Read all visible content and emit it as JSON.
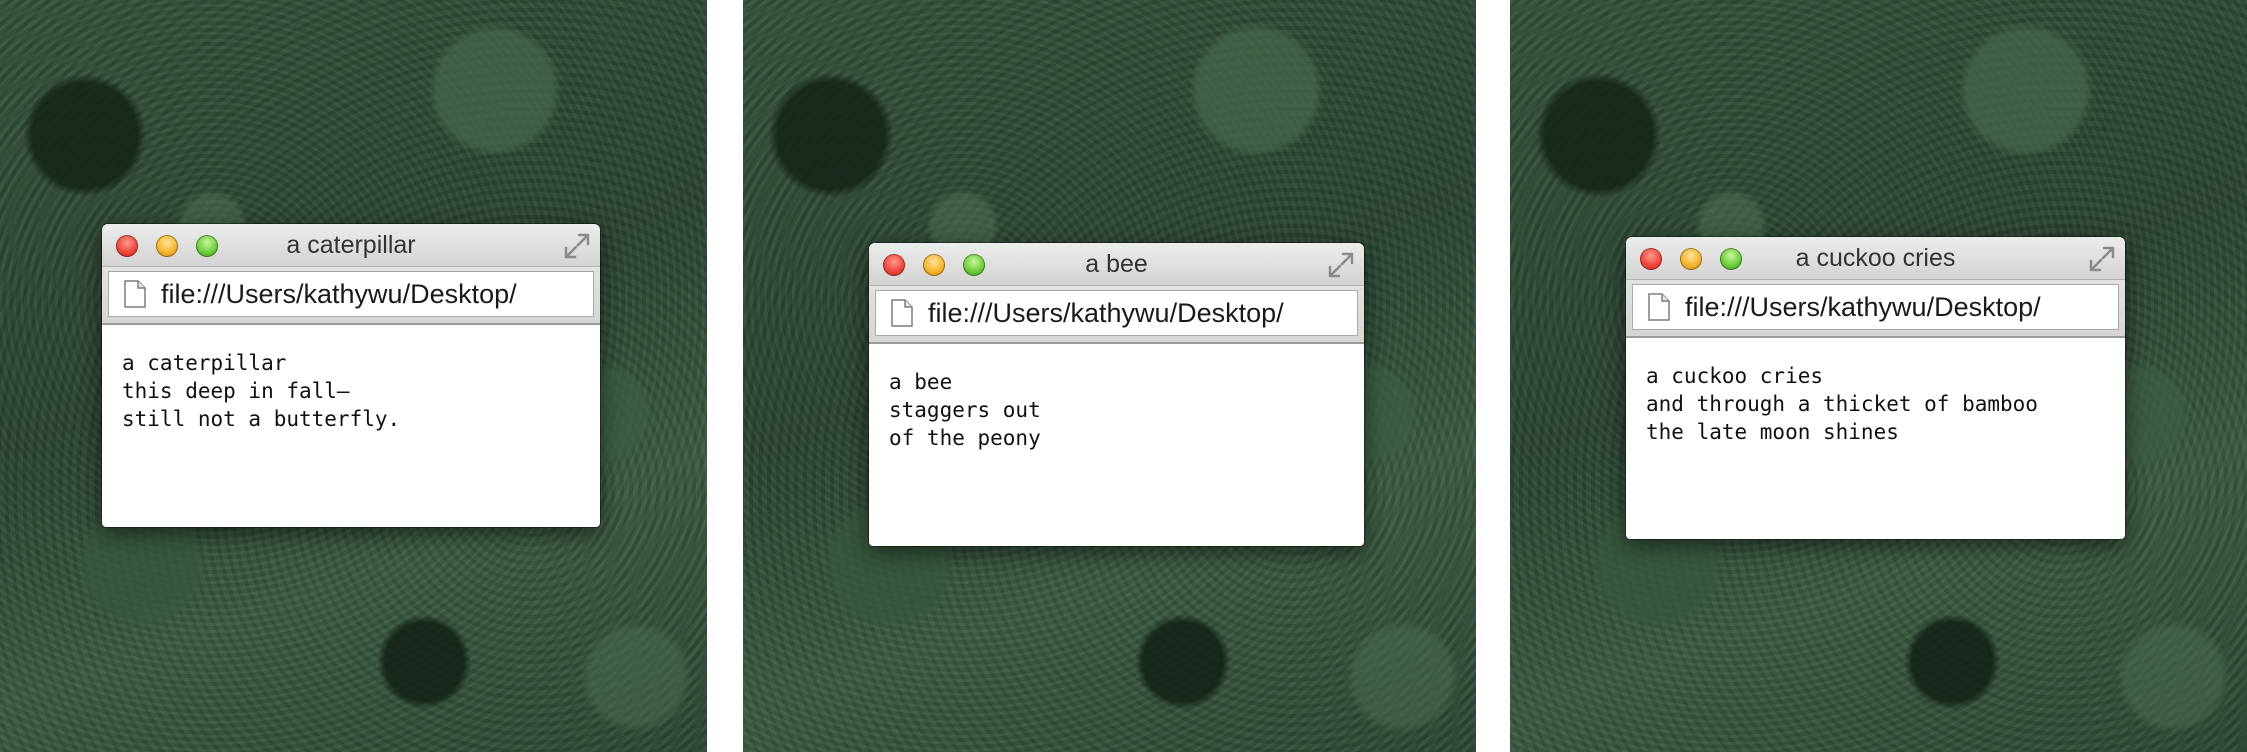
{
  "panels": [
    {
      "window": {
        "title": "a caterpillar",
        "url": "file:///Users/kathywu/Desktop/",
        "lines": [
          "a caterpillar",
          "this deep in fall—",
          "still not a butterfly."
        ]
      }
    },
    {
      "window": {
        "title": "a bee",
        "url": "file:///Users/kathywu/Desktop/",
        "lines": [
          "a bee",
          "staggers out",
          "of the peony"
        ]
      }
    },
    {
      "window": {
        "title": "a cuckoo cries",
        "url": "file:///Users/kathywu/Desktop/",
        "lines": [
          "a cuckoo cries",
          "and through a thicket of bamboo",
          "the late moon shines"
        ]
      }
    }
  ],
  "icons": {
    "close": "close-icon",
    "minimize": "minimize-icon",
    "zoom": "zoom-icon",
    "fullscreen": "fullscreen-icon",
    "page": "document-icon"
  },
  "colors": {
    "background": "#2f4a35",
    "close": "#f0463a",
    "minimize": "#f5b42d",
    "zoom": "#6ccd3b"
  }
}
